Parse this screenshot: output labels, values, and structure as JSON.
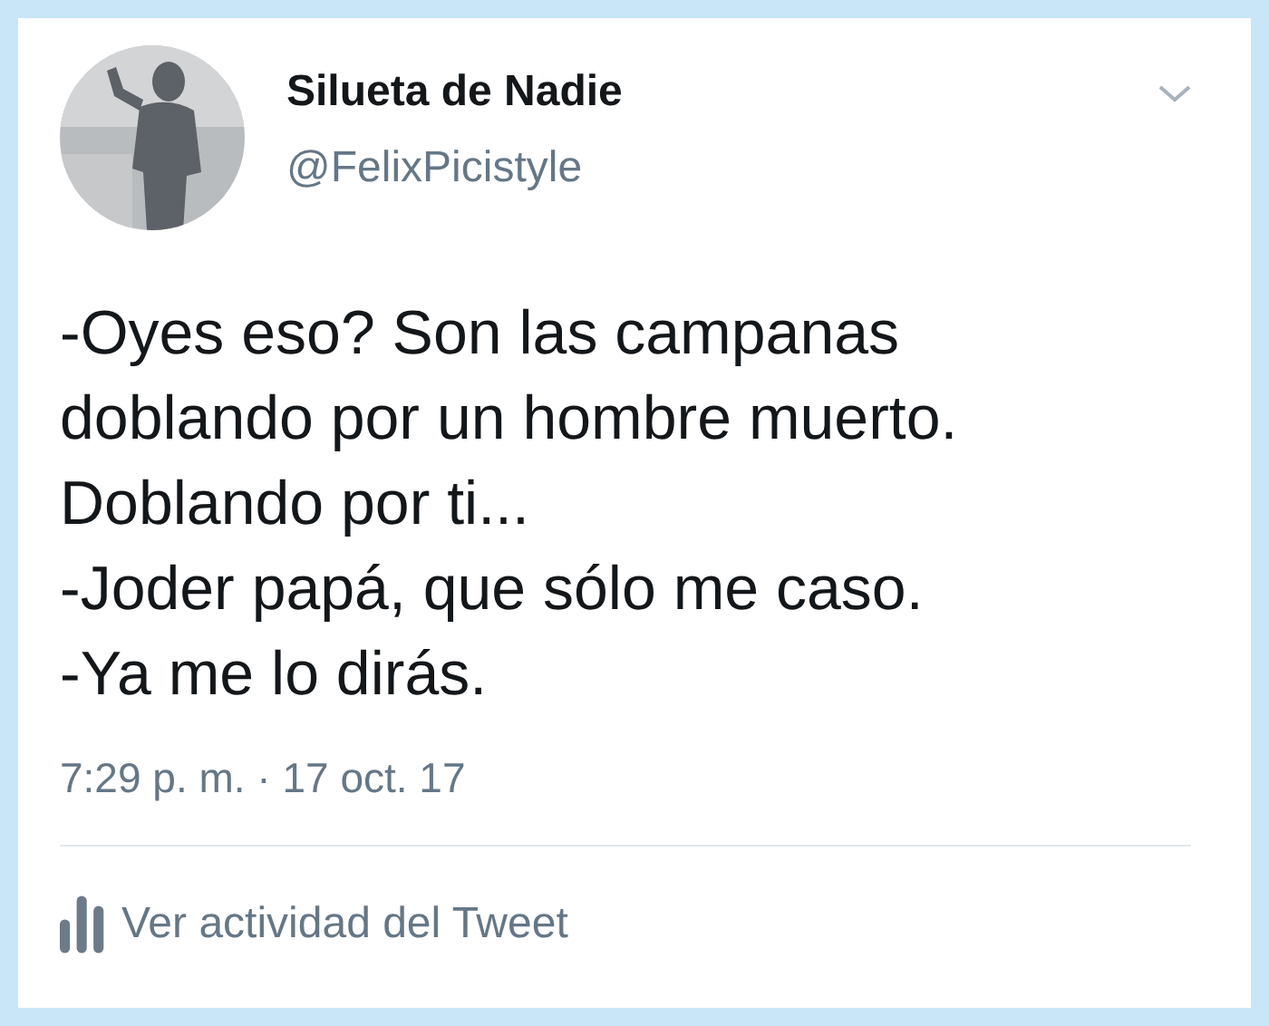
{
  "tweet": {
    "author": {
      "name": "Silueta de Nadie",
      "handle": "@FelixPicistyle"
    },
    "text": "-Oyes eso? Son las campanas\ndoblando por un hombre muerto.\nDoblando por ti...\n-Joder papá, que sólo me caso.\n-Ya me lo dirás.",
    "timestamp": "7:29 p. m. · 17 oct. 17",
    "activity_link": "Ver actividad del Tweet"
  }
}
